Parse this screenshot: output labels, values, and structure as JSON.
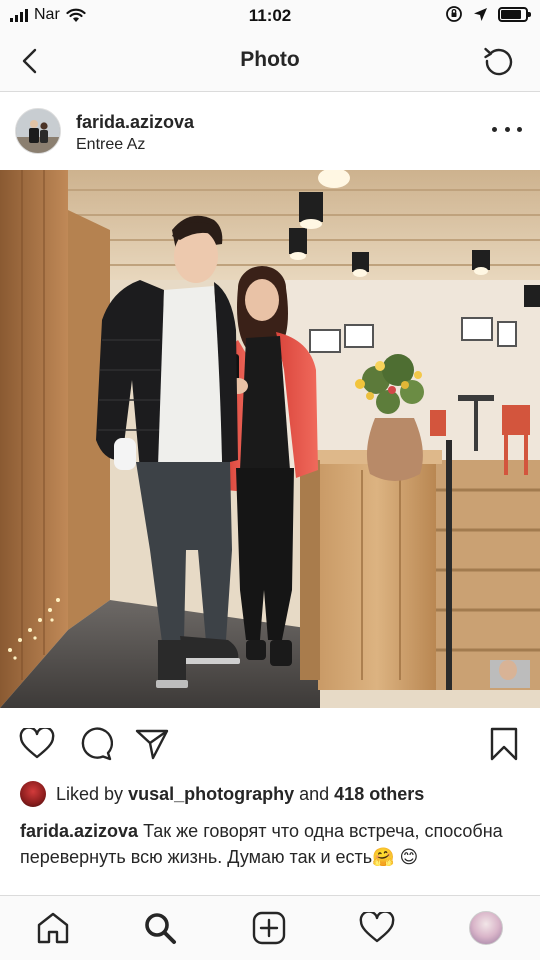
{
  "status_bar": {
    "carrier": "Nar",
    "time": "11:02"
  },
  "nav": {
    "title": "Photo"
  },
  "post": {
    "username": "farida.azizova",
    "location": "Entree Az"
  },
  "likes": {
    "prefix": "Liked by",
    "liker": "vusal_photography",
    "connector": "and",
    "others": "418 others"
  },
  "caption": {
    "username": "farida.azizova",
    "text": "Так же говорят что одна встреча, способна перевернуть всю жизнь. Думаю так и есть🤗 😊"
  },
  "icons": {
    "back": "chevron-left-icon",
    "refresh": "refresh-icon",
    "more": "more-options-icon",
    "like": "heart-icon",
    "comment": "comment-icon",
    "share": "paper-plane-icon",
    "save": "bookmark-icon",
    "home": "home-icon",
    "search": "search-icon",
    "add": "add-post-icon",
    "activity": "heart-icon",
    "profile": "profile-avatar"
  },
  "colors": {
    "text": "#262626",
    "divider": "#dbdbdb",
    "bar_background": "#fafafa",
    "battery_level": 0.8
  }
}
